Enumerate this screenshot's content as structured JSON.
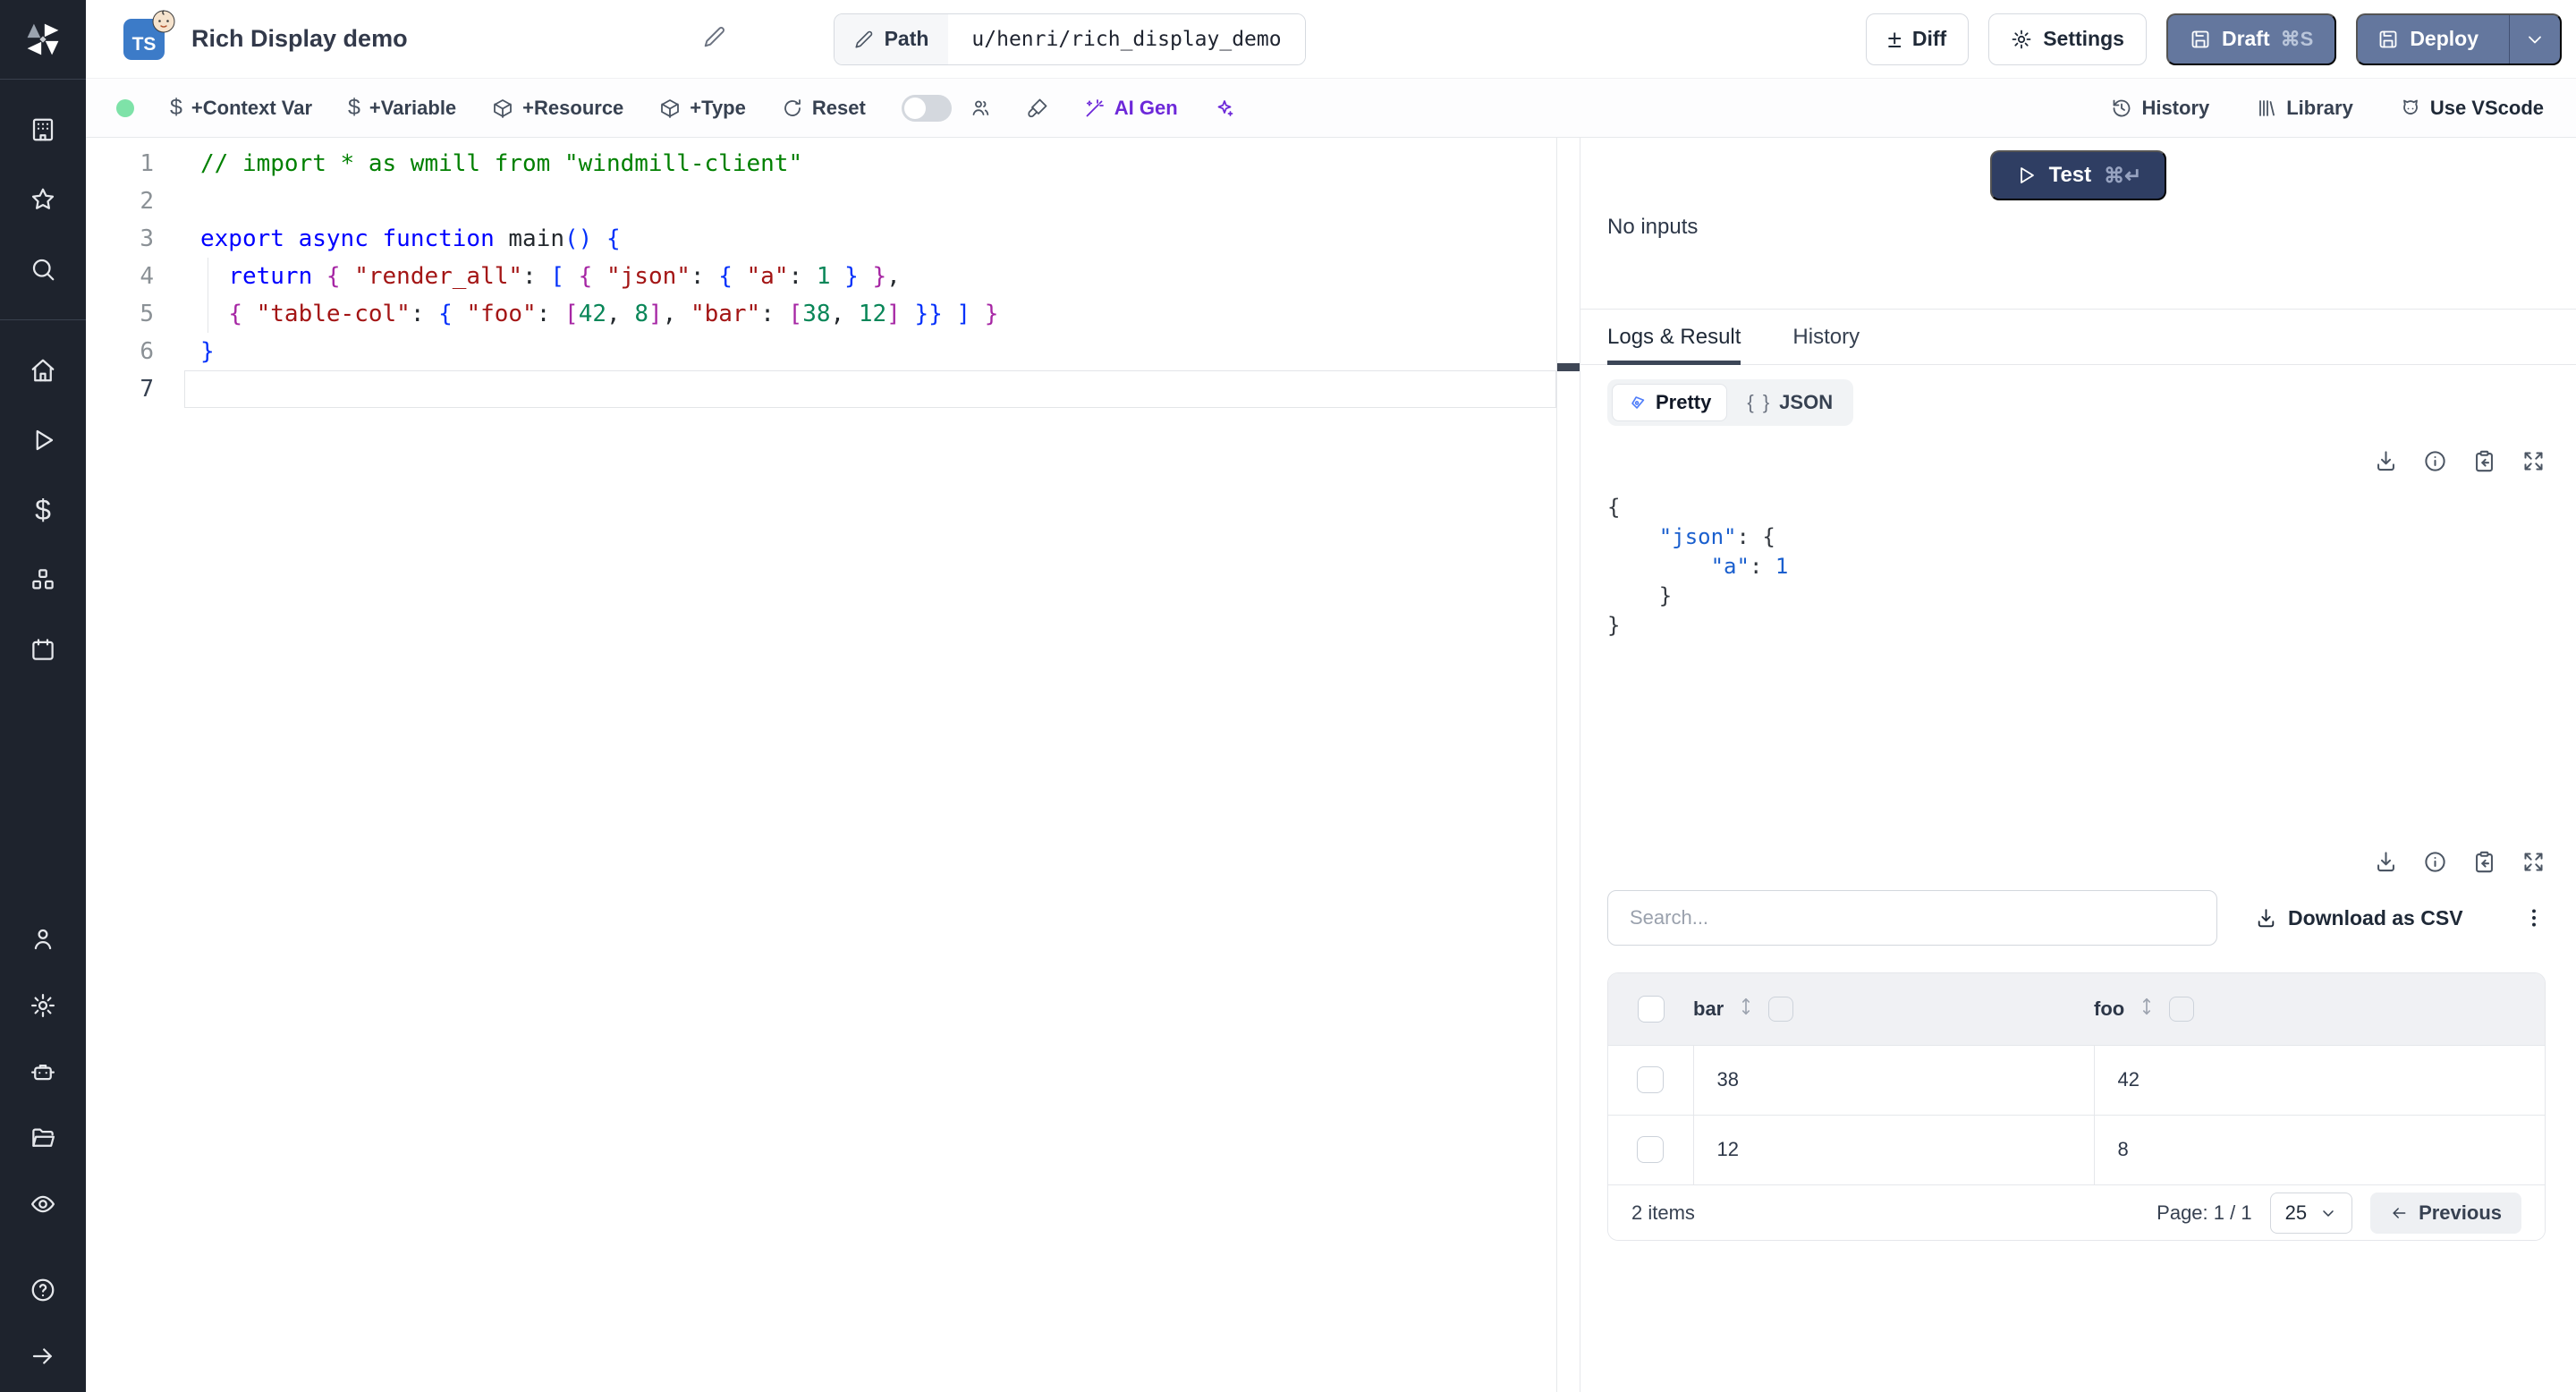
{
  "header": {
    "language_badge": "TS",
    "badge_emoji": "👶",
    "title": "Rich Display demo",
    "path_label": "Path",
    "path_value": "u/henri/rich_display_demo",
    "diff_label": "Diff",
    "settings_label": "Settings",
    "draft_label": "Draft",
    "draft_shortcut": "⌘S",
    "deploy_label": "Deploy"
  },
  "toolbar": {
    "context_var_label": "+Context Var",
    "variable_label": "+Variable",
    "resource_label": "+Resource",
    "type_label": "+Type",
    "reset_label": "Reset",
    "ai_gen_label": "AI Gen",
    "history_label": "History",
    "library_label": "Library",
    "vscode_label": "Use VScode"
  },
  "editor": {
    "active_line": 7,
    "lines": [
      {
        "n": 1,
        "tokens": [
          {
            "t": "// import * as wmill from \"windmill-client\"",
            "c": "cmt"
          }
        ]
      },
      {
        "n": 2,
        "tokens": []
      },
      {
        "n": 3,
        "tokens": [
          {
            "t": "export",
            "c": "kw"
          },
          {
            "t": " ",
            "c": "pln"
          },
          {
            "t": "async",
            "c": "kw"
          },
          {
            "t": " ",
            "c": "pln"
          },
          {
            "t": "function",
            "c": "kw"
          },
          {
            "t": " main",
            "c": "pln"
          },
          {
            "t": "()",
            "c": "br1"
          },
          {
            "t": " ",
            "c": "pln"
          },
          {
            "t": "{",
            "c": "br1"
          }
        ]
      },
      {
        "n": 4,
        "tokens": [
          {
            "t": "  ",
            "c": "pln"
          },
          {
            "t": "return",
            "c": "kw"
          },
          {
            "t": " ",
            "c": "pln"
          },
          {
            "t": "{",
            "c": "br2"
          },
          {
            "t": " ",
            "c": "pln"
          },
          {
            "t": "\"render_all\"",
            "c": "str"
          },
          {
            "t": ": ",
            "c": "pln"
          },
          {
            "t": "[",
            "c": "br1"
          },
          {
            "t": " ",
            "c": "pln"
          },
          {
            "t": "{",
            "c": "br2"
          },
          {
            "t": " ",
            "c": "pln"
          },
          {
            "t": "\"json\"",
            "c": "str"
          },
          {
            "t": ": ",
            "c": "pln"
          },
          {
            "t": "{",
            "c": "br1"
          },
          {
            "t": " ",
            "c": "pln"
          },
          {
            "t": "\"a\"",
            "c": "str"
          },
          {
            "t": ": ",
            "c": "pln"
          },
          {
            "t": "1",
            "c": "num"
          },
          {
            "t": " ",
            "c": "pln"
          },
          {
            "t": "}",
            "c": "br1"
          },
          {
            "t": " ",
            "c": "pln"
          },
          {
            "t": "}",
            "c": "br2"
          },
          {
            "t": ",",
            "c": "pln"
          }
        ]
      },
      {
        "n": 5,
        "tokens": [
          {
            "t": "  ",
            "c": "pln"
          },
          {
            "t": "{",
            "c": "br2"
          },
          {
            "t": " ",
            "c": "pln"
          },
          {
            "t": "\"table-col\"",
            "c": "str"
          },
          {
            "t": ": ",
            "c": "pln"
          },
          {
            "t": "{",
            "c": "br1"
          },
          {
            "t": " ",
            "c": "pln"
          },
          {
            "t": "\"foo\"",
            "c": "str"
          },
          {
            "t": ": ",
            "c": "pln"
          },
          {
            "t": "[",
            "c": "br2"
          },
          {
            "t": "42",
            "c": "num"
          },
          {
            "t": ", ",
            "c": "pln"
          },
          {
            "t": "8",
            "c": "num"
          },
          {
            "t": "]",
            "c": "br2"
          },
          {
            "t": ", ",
            "c": "pln"
          },
          {
            "t": "\"bar\"",
            "c": "str"
          },
          {
            "t": ": ",
            "c": "pln"
          },
          {
            "t": "[",
            "c": "br2"
          },
          {
            "t": "38",
            "c": "num"
          },
          {
            "t": ", ",
            "c": "pln"
          },
          {
            "t": "12",
            "c": "num"
          },
          {
            "t": "]",
            "c": "br2"
          },
          {
            "t": " ",
            "c": "pln"
          },
          {
            "t": "}}",
            "c": "br1"
          },
          {
            "t": " ",
            "c": "pln"
          },
          {
            "t": "]",
            "c": "br1"
          },
          {
            "t": " ",
            "c": "pln"
          },
          {
            "t": "}",
            "c": "br2"
          }
        ]
      },
      {
        "n": 6,
        "tokens": [
          {
            "t": "}",
            "c": "br1"
          }
        ]
      },
      {
        "n": 7,
        "tokens": []
      }
    ]
  },
  "run_panel": {
    "test_label": "Test",
    "test_shortcut": "⌘↵",
    "no_inputs_label": "No inputs",
    "tabs": [
      {
        "label": "Logs & Result",
        "active": true
      },
      {
        "label": "History",
        "active": false
      }
    ],
    "view_modes": [
      {
        "label": "Pretty",
        "active": true
      },
      {
        "label": "JSON",
        "active": false
      }
    ],
    "json_braces": "{ }",
    "result_json_lines": [
      {
        "tokens": [
          {
            "t": "{",
            "c": "jpln"
          }
        ]
      },
      {
        "tokens": [
          {
            "t": "    ",
            "c": "jpln"
          },
          {
            "t": "\"json\"",
            "c": "jkey"
          },
          {
            "t": ": ",
            "c": "jpln"
          },
          {
            "t": "{",
            "c": "jpln"
          }
        ]
      },
      {
        "tokens": [
          {
            "t": "        ",
            "c": "jpln"
          },
          {
            "t": "\"a\"",
            "c": "jkey"
          },
          {
            "t": ": ",
            "c": "jpln"
          },
          {
            "t": "1",
            "c": "jnum"
          }
        ]
      },
      {
        "tokens": [
          {
            "t": "    ",
            "c": "jpln"
          },
          {
            "t": "}",
            "c": "jpln"
          }
        ]
      },
      {
        "tokens": [
          {
            "t": "}",
            "c": "jpln"
          }
        ]
      }
    ],
    "table": {
      "search_placeholder": "Search...",
      "download_csv_label": "Download as CSV",
      "columns": [
        "bar",
        "foo"
      ],
      "rows": [
        [
          "38",
          "42"
        ],
        [
          "12",
          "8"
        ]
      ],
      "items_count_label": "2 items",
      "page_label": "Page: 1 / 1",
      "page_size": "25",
      "previous_label": "Previous"
    }
  },
  "colors": {
    "sidebar_bg": "#1e232d",
    "accent_slate": "#64779e",
    "test_navy": "#2f3e63",
    "ai_purple": "#6d28d9",
    "status_green": "#7ee2a8",
    "ts_badge_blue": "#3c7bc8",
    "comment_green": "#008000",
    "keyword_blue": "#0000ff",
    "string_red": "#a31515",
    "number_green": "#098658",
    "json_blue": "#1a5fce"
  }
}
